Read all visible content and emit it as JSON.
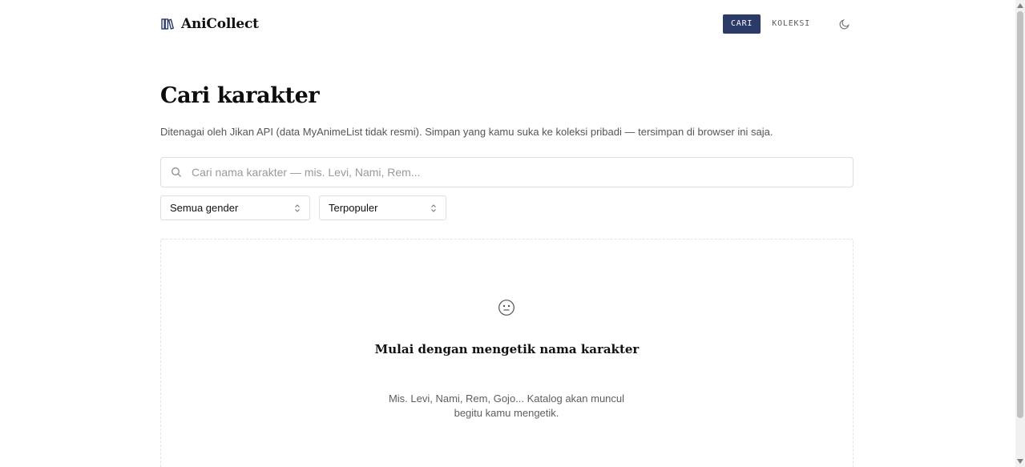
{
  "header": {
    "brand_name": "AniCollect",
    "brand_icon": "books-icon",
    "nav": [
      {
        "label": "CARI",
        "active": true
      },
      {
        "label": "KOLEKSI",
        "active": false
      }
    ],
    "theme_toggle_icon": "moon-icon"
  },
  "main": {
    "title": "Cari karakter",
    "subtitle": "Ditenagai oleh Jikan API (data MyAnimeList tidak resmi). Simpan yang kamu suka ke koleksi pribadi — tersimpan di browser ini saja.",
    "search": {
      "placeholder": "Cari nama karakter — mis. Levi, Nami, Rem...",
      "value": ""
    },
    "filters": {
      "gender": "Semua gender",
      "sort": "Terpopuler"
    },
    "empty_state": {
      "icon": "neutral-face-icon",
      "title": "Mulai dengan mengetik nama karakter",
      "description": "Mis. Levi, Nami, Rem, Gojo... Katalog akan muncul begitu kamu mengetik."
    }
  },
  "colors": {
    "accent": "#2b3a66",
    "text": "#111111",
    "muted": "#555555",
    "border": "#dedede"
  }
}
